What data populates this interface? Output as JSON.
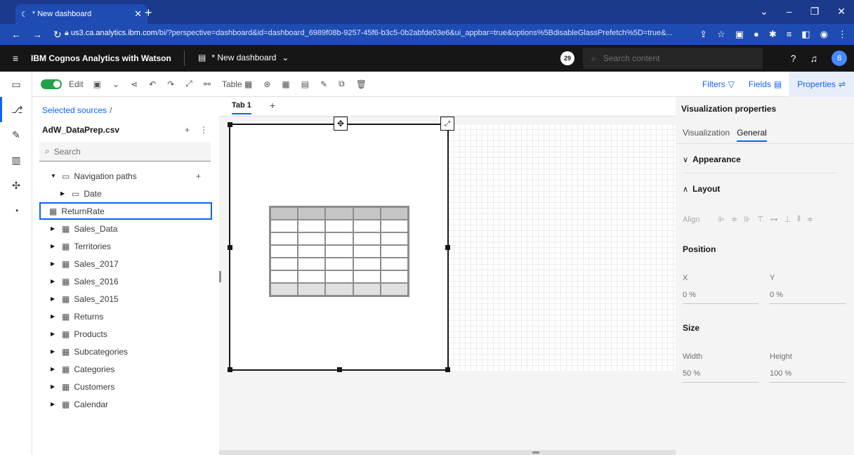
{
  "browser": {
    "tab_title": "* New dashboard",
    "url_host": "us3.ca.analytics.ibm.com",
    "url_rest": "/bi/?perspective=dashboard&id=dashboard_6989f08b-9257-45f6-b3c5-0b2abfde03e6&ui_appbar=true&options%5BdisableGlassPrefetch%5D=true&..."
  },
  "app": {
    "brand_prefix": "IBM ",
    "brand_name": "Cognos Analytics with Watson",
    "dashboard_name": "* New dashboard",
    "notification_count": "29",
    "search_placeholder": "Search content",
    "avatar_initial": "8"
  },
  "toolbar": {
    "edit_label": "Edit",
    "table_label": "Table",
    "filters_label": "Filters",
    "fields_label": "Fields",
    "properties_label": "Properties"
  },
  "sources": {
    "breadcrumb": "Selected sources",
    "breadcrumb_sep": "/",
    "source_name": "AdW_DataPrep.csv",
    "search_placeholder": "Search",
    "nav_paths": "Navigation paths",
    "date": "Date",
    "return_rate": "ReturnRate",
    "tables": [
      "Sales_Data",
      "Territories",
      "Sales_2017",
      "Sales_2016",
      "Sales_2015",
      "Returns",
      "Products",
      "Subcategories",
      "Categories",
      "Customers",
      "Calendar"
    ]
  },
  "canvas": {
    "tab_label": "Tab 1"
  },
  "properties": {
    "title": "Visualization properties",
    "tab_visualization": "Visualization",
    "tab_general": "General",
    "appearance": "Appearance",
    "layout": "Layout",
    "align_label": "Align",
    "position": "Position",
    "x_label": "X",
    "y_label": "Y",
    "x_value": "0 %",
    "y_value": "0 %",
    "size": "Size",
    "width_label": "Width",
    "height_label": "Height",
    "width_value": "50 %",
    "height_value": "100 %"
  },
  "colors": {
    "accent": "#0f62fe",
    "edit_toggle": "#24a148",
    "header_bg": "#161616",
    "browser_bg": "#1f4cb3"
  }
}
